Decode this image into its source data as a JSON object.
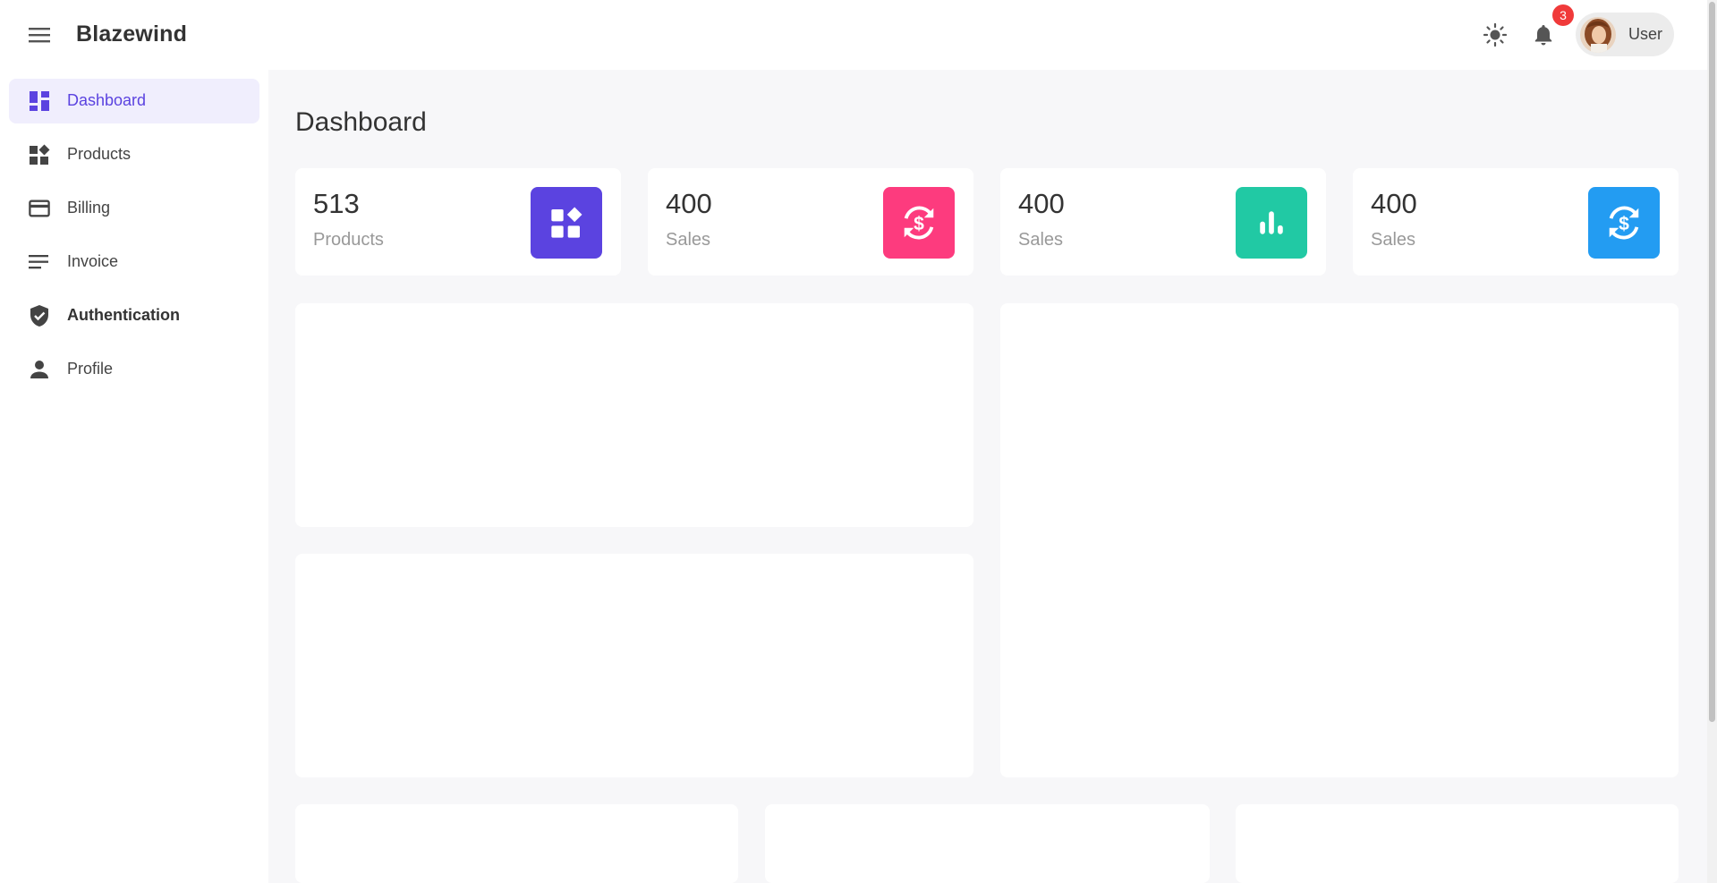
{
  "app": {
    "brand": "Blazewind"
  },
  "header": {
    "notification_count": "3",
    "user_label": "User"
  },
  "sidebar": {
    "items": [
      {
        "label": "Dashboard",
        "icon": "dashboard-icon",
        "active": true
      },
      {
        "label": "Products",
        "icon": "widgets-icon"
      },
      {
        "label": "Billing",
        "icon": "credit-card-icon"
      },
      {
        "label": "Invoice",
        "icon": "notes-icon"
      },
      {
        "label": "Authentication",
        "icon": "shield-check-icon"
      },
      {
        "label": "Profile",
        "icon": "person-icon"
      }
    ]
  },
  "main": {
    "title": "Dashboard",
    "stats": [
      {
        "value": "513",
        "label": "Products",
        "icon": "widgets-icon",
        "color": "#5b43e0"
      },
      {
        "value": "400",
        "label": "Sales",
        "icon": "currency-exchange-icon",
        "color": "#fd3b7e"
      },
      {
        "value": "400",
        "label": "Sales",
        "icon": "bar-chart-icon",
        "color": "#21c9a4"
      },
      {
        "value": "400",
        "label": "Sales",
        "icon": "currency-exchange-icon",
        "color": "#239cf2"
      }
    ]
  },
  "colors": {
    "accent": "#5b43e0",
    "active_bg": "#f0eefd",
    "page_bg": "#f7f7f9",
    "badge": "#f03a3a"
  }
}
